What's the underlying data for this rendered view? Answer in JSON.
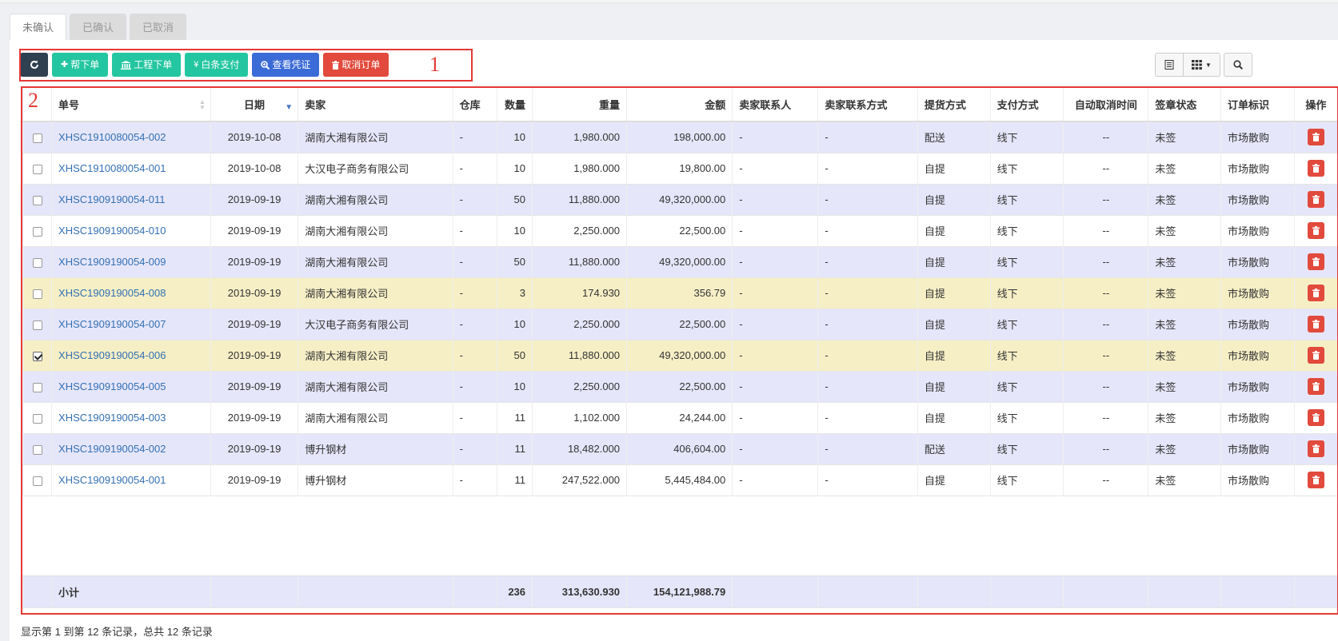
{
  "tabs": [
    {
      "label": "未确认",
      "active": true
    },
    {
      "label": "已确认",
      "active": false
    },
    {
      "label": "已取消",
      "active": false
    }
  ],
  "toolbar": {
    "refresh_icon": "refresh-icon",
    "buttons": [
      {
        "label": "帮下单",
        "icon": "plus-icon",
        "color": "#23c6a0"
      },
      {
        "label": "工程下单",
        "icon": "bank-icon",
        "color": "#23c6a0"
      },
      {
        "label": "白条支付",
        "icon": "yen-icon",
        "color": "#23c6a0"
      },
      {
        "label": "查看凭证",
        "icon": "search-plus-icon",
        "color": "#3b6bd6"
      },
      {
        "label": "取消订单",
        "icon": "trash-icon",
        "color": "#e14a3c"
      }
    ]
  },
  "annotations": {
    "one": "1",
    "two": "2",
    "color": "#e53935"
  },
  "columns": [
    "单号",
    "日期",
    "卖家",
    "仓库",
    "数量",
    "重量",
    "金额",
    "卖家联系人",
    "卖家联系方式",
    "提货方式",
    "支付方式",
    "自动取消时间",
    "签章状态",
    "订单标识",
    "操作"
  ],
  "rows": [
    {
      "order": "XHSC1910080054-002",
      "date": "2019-10-08",
      "seller": "湖南大湘有限公司",
      "warehouse": "-",
      "qty": "10",
      "weight": "1,980.000",
      "amount": "198,000.00",
      "contact": "-",
      "phone": "-",
      "pickup": "配送",
      "pay": "线下",
      "autocancel": "--",
      "sign": "未签",
      "tag": "市场散购",
      "checked": false,
      "highlight": false
    },
    {
      "order": "XHSC1910080054-001",
      "date": "2019-10-08",
      "seller": "大汉电子商务有限公司",
      "warehouse": "-",
      "qty": "10",
      "weight": "1,980.000",
      "amount": "19,800.00",
      "contact": "-",
      "phone": "-",
      "pickup": "自提",
      "pay": "线下",
      "autocancel": "--",
      "sign": "未签",
      "tag": "市场散购",
      "checked": false,
      "highlight": false
    },
    {
      "order": "XHSC1909190054-011",
      "date": "2019-09-19",
      "seller": "湖南大湘有限公司",
      "warehouse": "-",
      "qty": "50",
      "weight": "11,880.000",
      "amount": "49,320,000.00",
      "contact": "-",
      "phone": "-",
      "pickup": "自提",
      "pay": "线下",
      "autocancel": "--",
      "sign": "未签",
      "tag": "市场散购",
      "checked": false,
      "highlight": false
    },
    {
      "order": "XHSC1909190054-010",
      "date": "2019-09-19",
      "seller": "湖南大湘有限公司",
      "warehouse": "-",
      "qty": "10",
      "weight": "2,250.000",
      "amount": "22,500.00",
      "contact": "-",
      "phone": "-",
      "pickup": "自提",
      "pay": "线下",
      "autocancel": "--",
      "sign": "未签",
      "tag": "市场散购",
      "checked": false,
      "highlight": false
    },
    {
      "order": "XHSC1909190054-009",
      "date": "2019-09-19",
      "seller": "湖南大湘有限公司",
      "warehouse": "-",
      "qty": "50",
      "weight": "11,880.000",
      "amount": "49,320,000.00",
      "contact": "-",
      "phone": "-",
      "pickup": "自提",
      "pay": "线下",
      "autocancel": "--",
      "sign": "未签",
      "tag": "市场散购",
      "checked": false,
      "highlight": false
    },
    {
      "order": "XHSC1909190054-008",
      "date": "2019-09-19",
      "seller": "湖南大湘有限公司",
      "warehouse": "-",
      "qty": "3",
      "weight": "174.930",
      "amount": "356.79",
      "contact": "-",
      "phone": "-",
      "pickup": "自提",
      "pay": "线下",
      "autocancel": "--",
      "sign": "未签",
      "tag": "市场散购",
      "checked": false,
      "highlight": true
    },
    {
      "order": "XHSC1909190054-007",
      "date": "2019-09-19",
      "seller": "大汉电子商务有限公司",
      "warehouse": "-",
      "qty": "10",
      "weight": "2,250.000",
      "amount": "22,500.00",
      "contact": "-",
      "phone": "-",
      "pickup": "自提",
      "pay": "线下",
      "autocancel": "--",
      "sign": "未签",
      "tag": "市场散购",
      "checked": false,
      "highlight": false
    },
    {
      "order": "XHSC1909190054-006",
      "date": "2019-09-19",
      "seller": "湖南大湘有限公司",
      "warehouse": "-",
      "qty": "50",
      "weight": "11,880.000",
      "amount": "49,320,000.00",
      "contact": "-",
      "phone": "-",
      "pickup": "自提",
      "pay": "线下",
      "autocancel": "--",
      "sign": "未签",
      "tag": "市场散购",
      "checked": true,
      "highlight": true
    },
    {
      "order": "XHSC1909190054-005",
      "date": "2019-09-19",
      "seller": "湖南大湘有限公司",
      "warehouse": "-",
      "qty": "10",
      "weight": "2,250.000",
      "amount": "22,500.00",
      "contact": "-",
      "phone": "-",
      "pickup": "自提",
      "pay": "线下",
      "autocancel": "--",
      "sign": "未签",
      "tag": "市场散购",
      "checked": false,
      "highlight": false
    },
    {
      "order": "XHSC1909190054-003",
      "date": "2019-09-19",
      "seller": "湖南大湘有限公司",
      "warehouse": "-",
      "qty": "11",
      "weight": "1,102.000",
      "amount": "24,244.00",
      "contact": "-",
      "phone": "-",
      "pickup": "自提",
      "pay": "线下",
      "autocancel": "--",
      "sign": "未签",
      "tag": "市场散购",
      "checked": false,
      "highlight": false
    },
    {
      "order": "XHSC1909190054-002",
      "date": "2019-09-19",
      "seller": "博升钢材",
      "warehouse": "-",
      "qty": "11",
      "weight": "18,482.000",
      "amount": "406,604.00",
      "contact": "-",
      "phone": "-",
      "pickup": "配送",
      "pay": "线下",
      "autocancel": "--",
      "sign": "未签",
      "tag": "市场散购",
      "checked": false,
      "highlight": false
    },
    {
      "order": "XHSC1909190054-001",
      "date": "2019-09-19",
      "seller": "博升钢材",
      "warehouse": "-",
      "qty": "11",
      "weight": "247,522.000",
      "amount": "5,445,484.00",
      "contact": "-",
      "phone": "-",
      "pickup": "自提",
      "pay": "线下",
      "autocancel": "--",
      "sign": "未签",
      "tag": "市场散购",
      "checked": false,
      "highlight": false
    }
  ],
  "totals": {
    "label": "小计",
    "qty": "236",
    "weight": "313,630.930",
    "amount": "154,121,988.79"
  },
  "footer": "显示第 1 到第 12 条记录，总共 12 条记录",
  "colors": {
    "row_even": "#e6e6fa",
    "row_highlight": "#f6efc6",
    "link": "#3470b4",
    "delete": "#e14a3c"
  }
}
